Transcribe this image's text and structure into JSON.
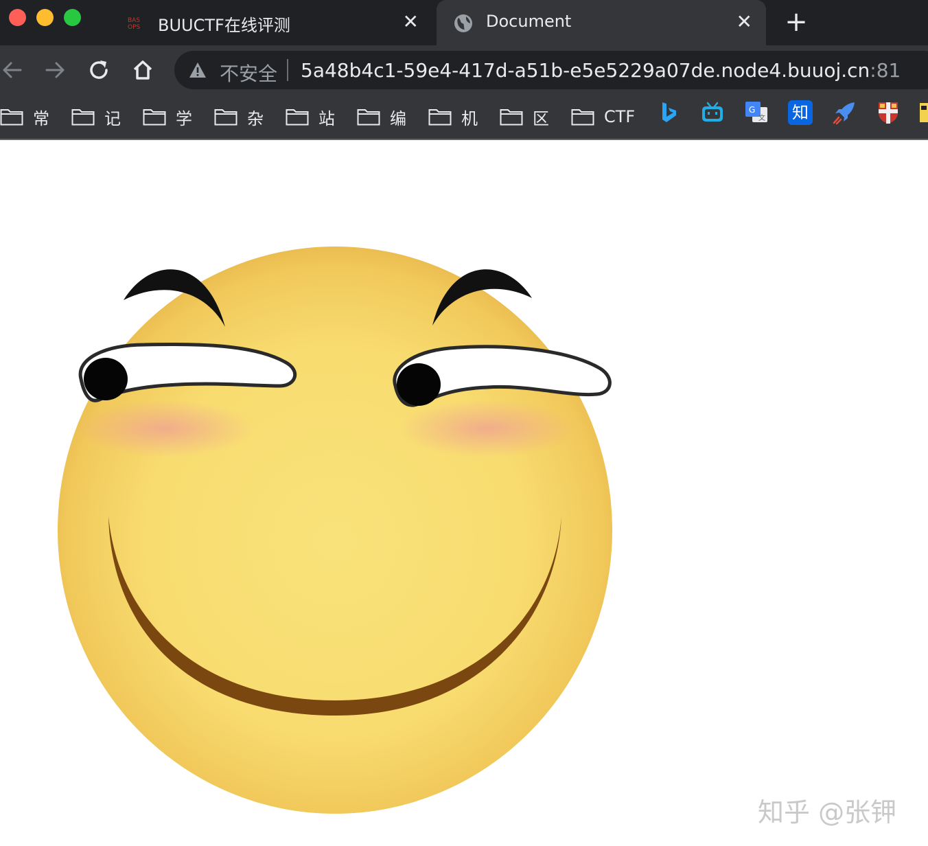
{
  "tabs": [
    {
      "title": "BUUCTF在线评测",
      "favicon": "buuctf-favicon",
      "close": "✕",
      "active": false
    },
    {
      "title": "Document",
      "favicon": "globe-icon",
      "close": "✕",
      "active": true
    }
  ],
  "new_tab_label": "+",
  "address_bar": {
    "security_label": "不安全",
    "host": "5a48b4c1-59e4-417d-a51b-e5e5229a07de.node4.buuoj.cn",
    "port": ":81"
  },
  "bookmarks": {
    "folders": [
      "常",
      "记",
      "学",
      "杂",
      "站",
      "编",
      "机",
      "区",
      "CTF"
    ],
    "icons": [
      "bing-icon",
      "bilibili-icon",
      "google-translate-icon",
      "zhihu-icon",
      "rocket-icon",
      "cambridge-crest-icon",
      "extra-icon"
    ],
    "zhihu_label": "知"
  },
  "page": {
    "image": "smirking-emoji-face",
    "watermark": "知乎 @张钾"
  },
  "colors": {
    "chrome_dark": "#202124",
    "toolbar": "#35363a",
    "face_yellow": "#f7d96a",
    "face_edge": "#e9b84a"
  }
}
